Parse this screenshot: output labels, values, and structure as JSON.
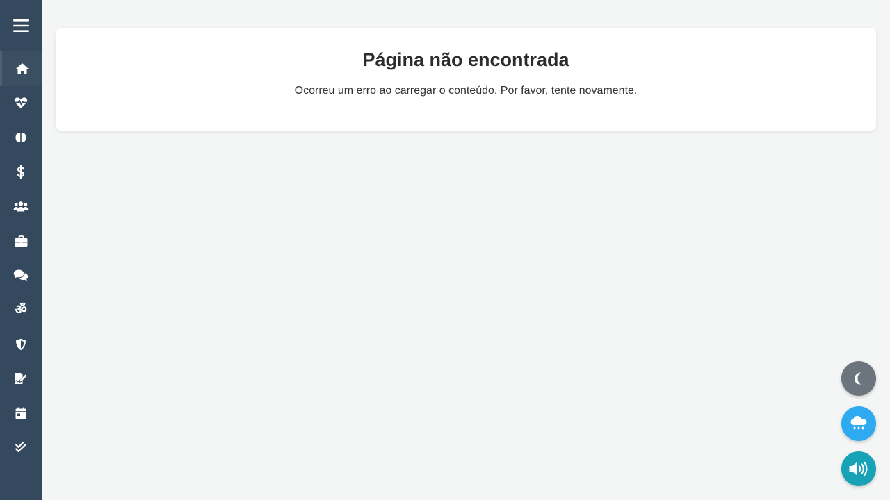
{
  "sidebar": {
    "menu_icon": "hamburger-icon",
    "items": [
      {
        "key": "home",
        "icon": "home-icon",
        "active": true
      },
      {
        "key": "health",
        "icon": "heartbeat-icon",
        "active": false
      },
      {
        "key": "mind",
        "icon": "brain-icon",
        "active": false
      },
      {
        "key": "finance",
        "icon": "dollar-icon",
        "active": false
      },
      {
        "key": "people",
        "icon": "users-icon",
        "active": false
      },
      {
        "key": "work",
        "icon": "briefcase-icon",
        "active": false
      },
      {
        "key": "chat",
        "icon": "comments-icon",
        "active": false
      },
      {
        "key": "spiritual",
        "icon": "om-icon",
        "active": false
      },
      {
        "key": "security",
        "icon": "shield-icon",
        "active": false
      },
      {
        "key": "journal",
        "icon": "signature-icon",
        "active": false
      },
      {
        "key": "calendar",
        "icon": "calendar-icon",
        "active": false
      },
      {
        "key": "tasks",
        "icon": "double-check-icon",
        "active": false
      }
    ],
    "om_glyph": "ॐ"
  },
  "main": {
    "title": "Página não encontrada",
    "message": "Ocorreu um erro ao carregar o conteúdo. Por favor, tente novamente."
  },
  "floating_buttons": [
    {
      "key": "dark-mode",
      "icon": "moon-icon",
      "color": "#6c757d"
    },
    {
      "key": "weather",
      "icon": "cloud-rain-icon",
      "color": "#2eaaf0"
    },
    {
      "key": "audio",
      "icon": "volume-icon",
      "color": "#17a2b8"
    }
  ],
  "colors": {
    "sidebar_bg": "#34495e",
    "page_bg": "#f4f5f5",
    "card_bg": "#ffffff"
  }
}
